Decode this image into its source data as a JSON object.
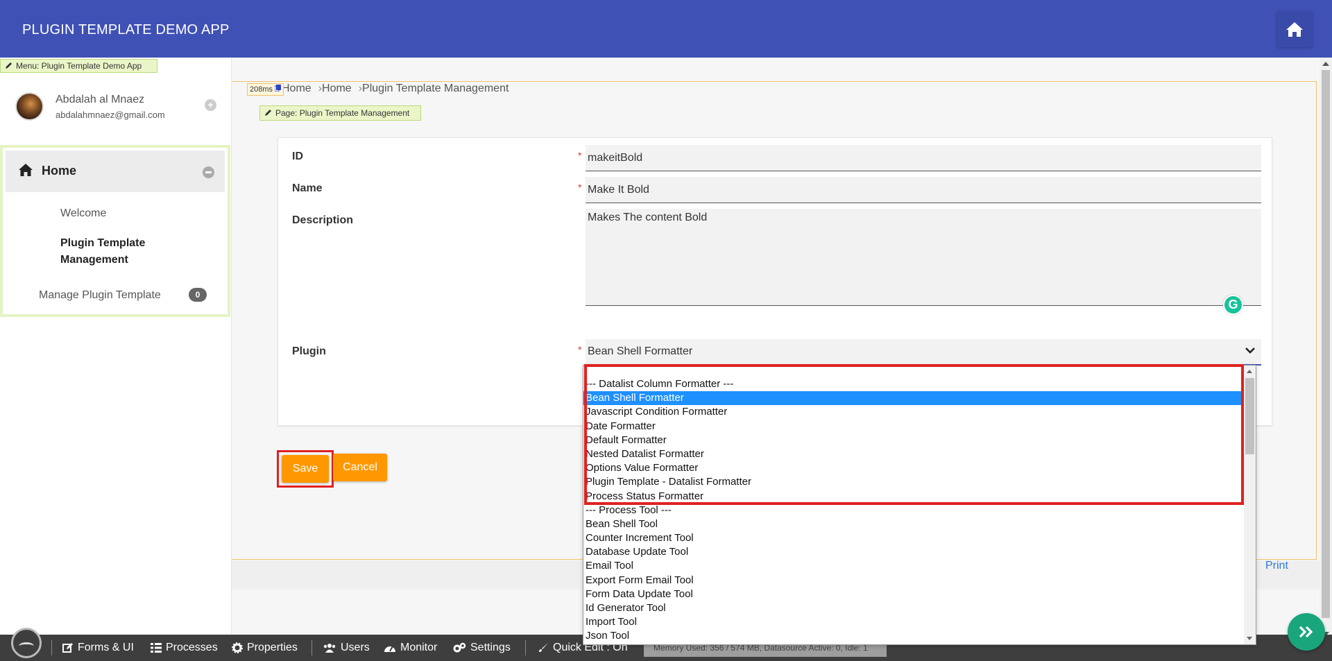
{
  "header": {
    "title": "PLUGIN TEMPLATE DEMO APP"
  },
  "sidebar": {
    "menu_tag": "Menu: Plugin Template Demo App",
    "profile": {
      "name": "Abdalah al Mnaez",
      "email": "abdalahmnaez@gmail.com"
    },
    "home_label": "Home",
    "items": [
      {
        "label": "Welcome"
      },
      {
        "label": "Plugin Template Management"
      },
      {
        "label": "Manage Plugin Template",
        "badge": "0"
      }
    ]
  },
  "main": {
    "timing": "208ms",
    "breadcrumb": [
      "Home",
      "Home",
      "Plugin Template Management"
    ],
    "page_tag": "Page: Plugin Template Management",
    "form": {
      "id": {
        "label": "ID",
        "value": "makeitBold"
      },
      "name": {
        "label": "Name",
        "value": "Make It Bold"
      },
      "description": {
        "label": "Description",
        "value": "Makes The content Bold"
      },
      "plugin": {
        "label": "Plugin",
        "value": "Bean Shell Formatter"
      },
      "required_mark": "*"
    },
    "buttons": {
      "save": "Save",
      "cancel": "Cancel"
    },
    "print_label": "Print"
  },
  "dropdown": {
    "options": [
      "--- Datalist Column Formatter ---",
      "Bean Shell Formatter",
      "Javascript Condition Formatter",
      "Date Formatter",
      "Default Formatter",
      "Nested Datalist Formatter",
      "Options Value Formatter",
      "Plugin Template - Datalist Formatter",
      "Process Status Formatter",
      "--- Process Tool ---",
      "Bean Shell Tool",
      "Counter Increment Tool",
      "Database Update Tool",
      "Email Tool",
      "Export Form Email Tool",
      "Form Data Update Tool",
      "Id Generator Tool",
      "Import Tool",
      "Json Tool"
    ],
    "selected": "Bean Shell Formatter"
  },
  "admin_bar": {
    "items": [
      {
        "icon": "pencil-square-icon",
        "label": "Forms & UI"
      },
      {
        "icon": "list-icon",
        "label": "Processes"
      },
      {
        "icon": "gear-icon",
        "label": "Properties"
      },
      {
        "icon": "users-icon",
        "label": "Users"
      },
      {
        "icon": "gauge-icon",
        "label": "Monitor"
      },
      {
        "icon": "gears-icon",
        "label": "Settings"
      },
      {
        "icon": "brush-icon",
        "label": "Quick Edit : On"
      }
    ],
    "memory": "Memory Used: 356 / 574 MB, Datasource Active: 0, Idle: 1"
  },
  "colors": {
    "header": "#3f51b5",
    "button": "#ff9800",
    "highlight": "#e02020",
    "selected_option": "#1e90ff",
    "fab": "#1aa67c"
  }
}
